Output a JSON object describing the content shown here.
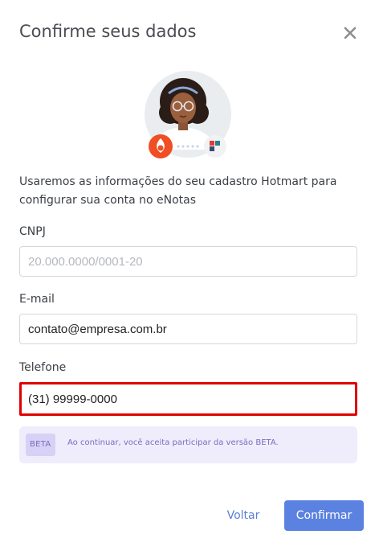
{
  "dialog": {
    "title": "Confirme seus dados",
    "close_icon": "close-icon"
  },
  "illustration": {
    "icons": [
      "avatar-illustration",
      "hotmart-logo-icon",
      "enotas-logo-icon"
    ]
  },
  "intro_text": "Usaremos as informações do seu cadastro Hotmart para configurar sua conta no eNotas",
  "form": {
    "cnpj": {
      "label": "CNPJ",
      "value": "",
      "placeholder": "20.000.0000/0001-20"
    },
    "email": {
      "label": "E-mail",
      "value": "contato@empresa.com.br"
    },
    "phone": {
      "label": "Telefone",
      "value": "(31) 99999-0000"
    }
  },
  "beta": {
    "badge": "BETA",
    "text": "Ao continuar, você aceita participar da versão BETA."
  },
  "buttons": {
    "back": "Voltar",
    "confirm": "Confirmar"
  },
  "colors": {
    "primary": "#5b82e0",
    "link": "#5b7fd6",
    "beta_bg": "#efedfb",
    "beta_text": "#7a6cc4",
    "highlight": "#e00000",
    "hotmart": "#f04e23"
  }
}
